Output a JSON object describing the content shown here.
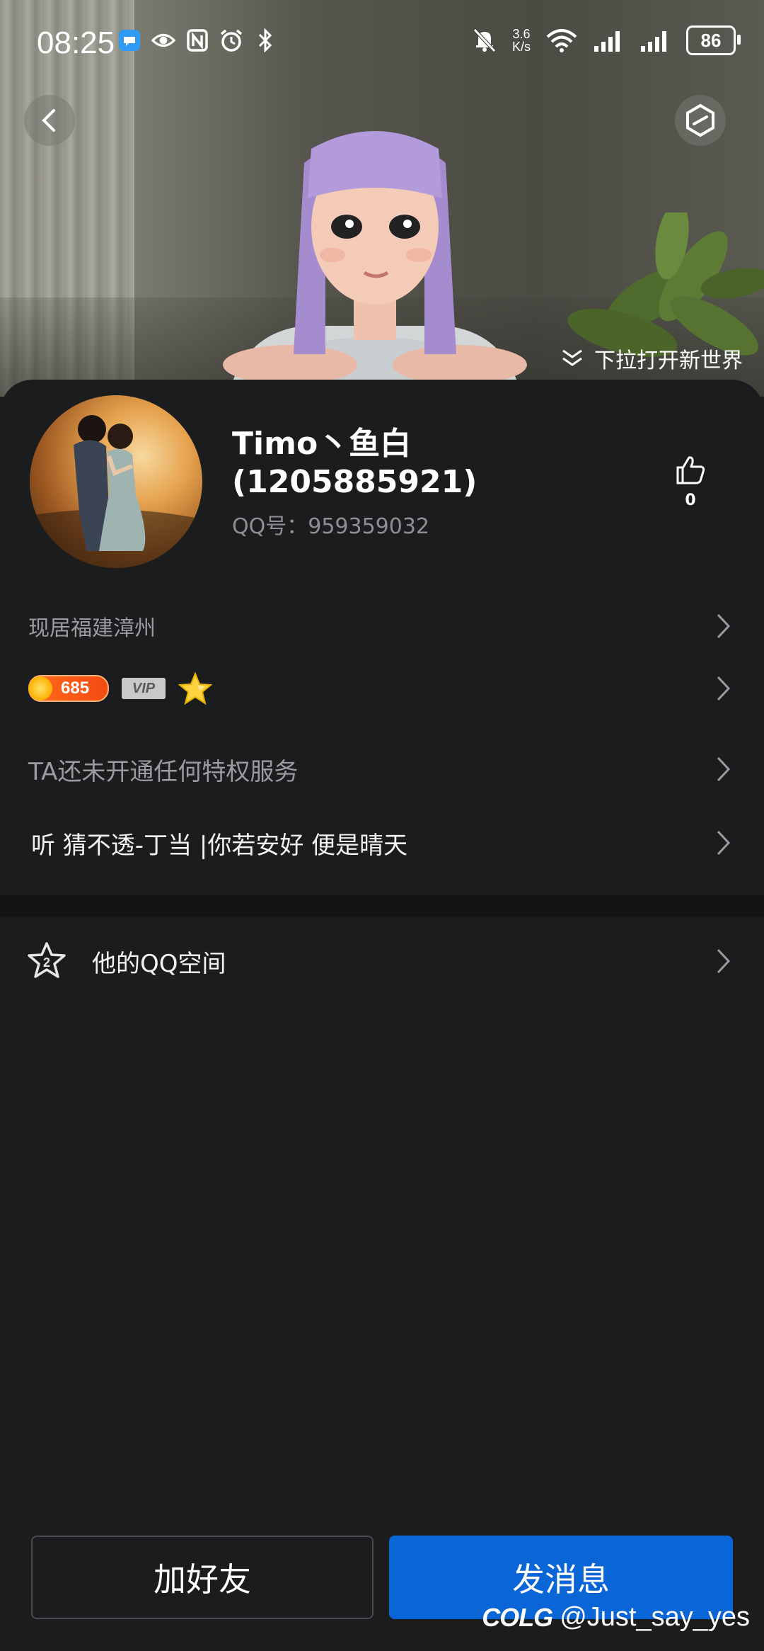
{
  "status_bar": {
    "time": "08:25",
    "net_speed_value": "3.6",
    "net_speed_unit": "K/s",
    "battery": "86",
    "left_icons": [
      "message-app-icon",
      "eye-icon",
      "nfc-icon",
      "alarm-icon",
      "bluetooth-icon"
    ],
    "right_icons": [
      "mute-bell-icon",
      "wifi-icon",
      "signal-icon",
      "signal-icon"
    ]
  },
  "header": {
    "pull_hint": "下拉打开新世界"
  },
  "profile": {
    "nickname": "Timo丶鱼白(1205885921)",
    "qq_label": "QQ号：",
    "qq_number": "959359032",
    "likes": "0"
  },
  "rows": {
    "location": "现居福建漳州",
    "level": "685",
    "vip_label": "VIP",
    "privilege": "TA还未开通任何特权服务",
    "signature": "听 猜不透-丁当 |你若安好 便是晴天",
    "qzone": "他的QQ空间",
    "qzone_icon_number": "2"
  },
  "actions": {
    "add_friend": "加好友",
    "send_message": "发消息"
  },
  "watermark": {
    "logo": "COLG",
    "handle": "@Just_say_yes"
  },
  "colors": {
    "background": "#1b1c1e",
    "primary_button": "#0a66d6",
    "secondary_text": "#9a9b9f"
  }
}
